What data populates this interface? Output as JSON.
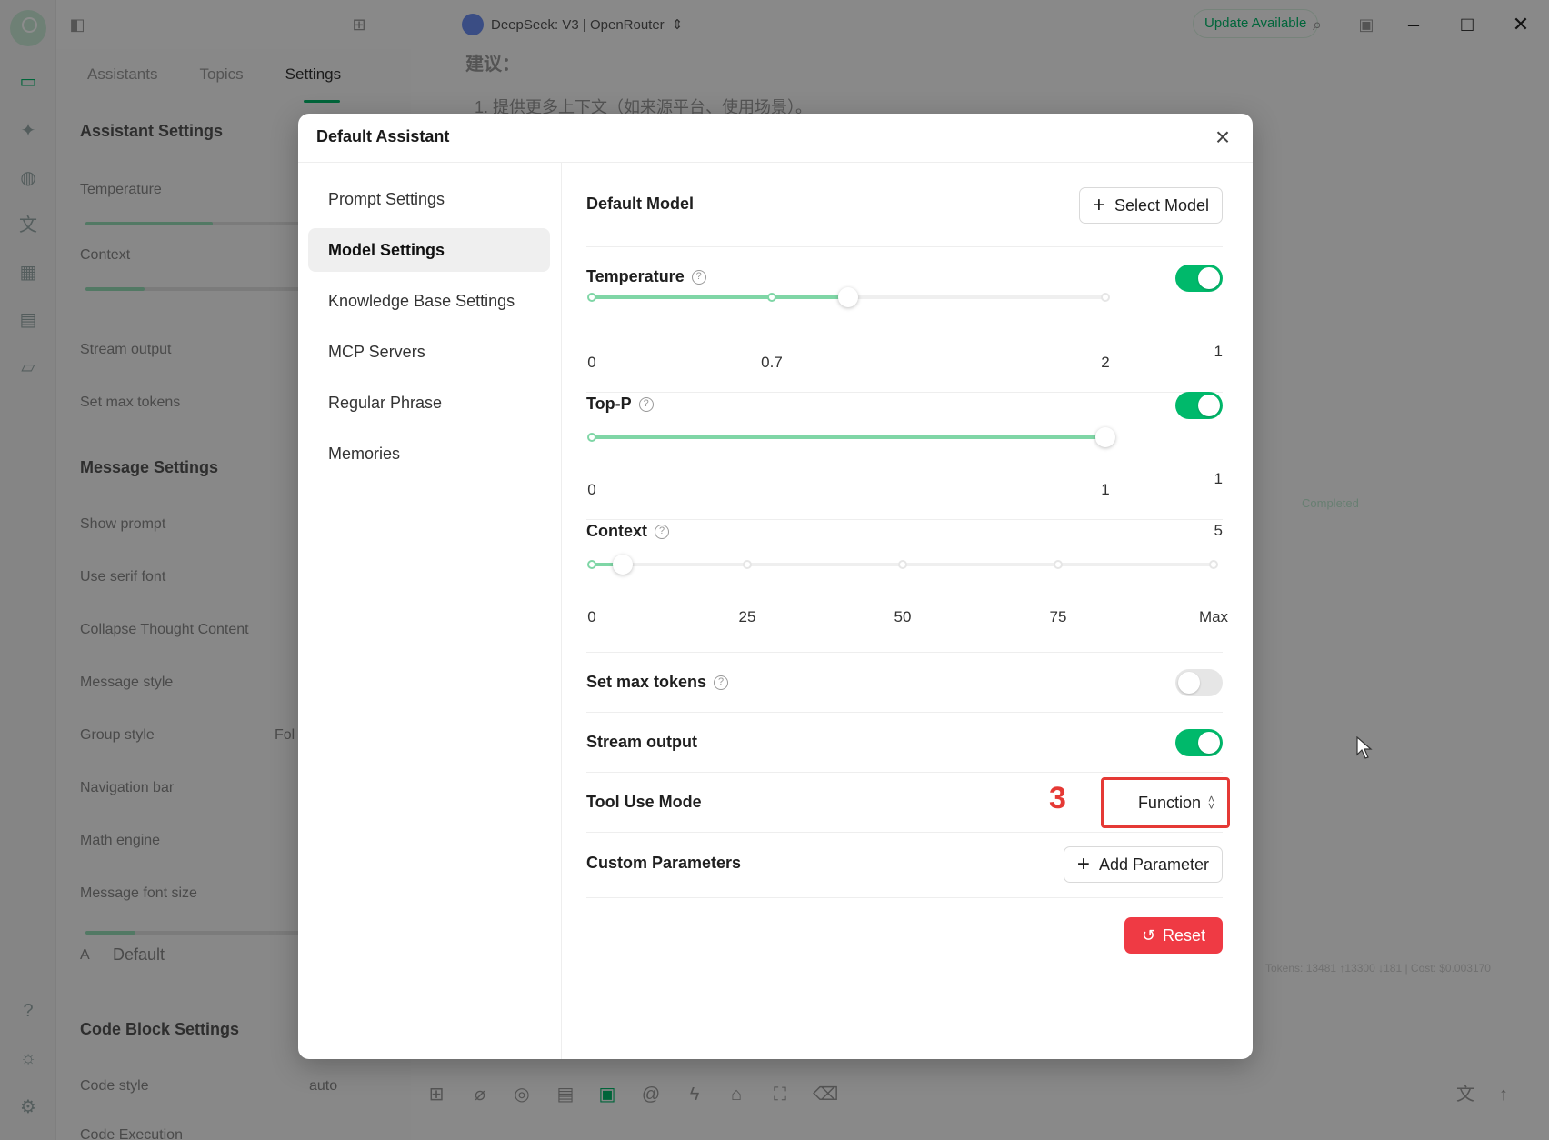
{
  "titlebar": {
    "model_label": "DeepSeek: V3 | OpenRouter",
    "update_label": "Update Available"
  },
  "sidebar_tabs": [
    "Assistants",
    "Topics",
    "Settings"
  ],
  "settings_pane": {
    "assistant_settings": "Assistant Settings",
    "temperature": "Temperature",
    "context": "Context",
    "stream_output": "Stream output",
    "set_max_tokens": "Set max tokens",
    "message_settings": "Message Settings",
    "show_prompt": "Show prompt",
    "use_serif_font": "Use serif font",
    "collapse_thought": "Collapse Thought Content",
    "message_style": "Message style",
    "group_style": "Group style",
    "group_style_value": "Fol",
    "navigation_bar": "Navigation bar",
    "math_engine": "Math engine",
    "message_font_size": "Message font size",
    "font_size_value": "Default",
    "font_size_prefix": "A",
    "code_block_settings": "Code Block Settings",
    "code_style": "Code style",
    "code_style_value": "auto",
    "code_execution": "Code Execution"
  },
  "chat": {
    "suggestion_heading": "建议：",
    "suggestion_line": "1. 提供更多上下文（如来源平台、使用场景）。",
    "status": "Completed",
    "tokens_line": "Tokens: 13481 ↑13300 ↓181 | Cost: $0.003170"
  },
  "modal": {
    "title": "Default Assistant",
    "menu": [
      "Prompt Settings",
      "Model Settings",
      "Knowledge Base Settings",
      "MCP Servers",
      "Regular Phrase",
      "Memories"
    ],
    "active_menu_index": 1,
    "default_model_label": "Default Model",
    "select_model_button": "Select Model",
    "temperature": {
      "label": "Temperature",
      "enabled": true,
      "value": "1",
      "marks": [
        "0",
        "0.7",
        "2"
      ]
    },
    "top_p": {
      "label": "Top-P",
      "enabled": true,
      "value": "1",
      "marks": [
        "0",
        "1"
      ]
    },
    "context": {
      "label": "Context",
      "value": "5",
      "marks": [
        "0",
        "25",
        "50",
        "75",
        "Max"
      ]
    },
    "set_max_tokens": {
      "label": "Set max tokens",
      "enabled": false
    },
    "stream_output": {
      "label": "Stream output",
      "enabled": true
    },
    "tool_use_mode": {
      "label": "Tool Use Mode",
      "value": "Function",
      "annotation": "3"
    },
    "custom_parameters": {
      "label": "Custom Parameters",
      "button": "Add Parameter"
    },
    "reset_button": "Reset"
  },
  "colors": {
    "accent": "#00b96b",
    "danger": "#ef3a44",
    "annotation": "#e53935"
  }
}
